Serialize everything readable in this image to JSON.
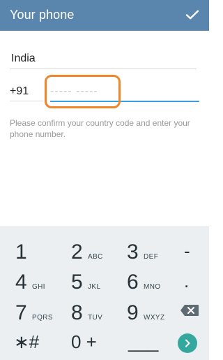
{
  "header": {
    "title": "Your phone",
    "confirm_icon": "checkmark-icon"
  },
  "form": {
    "country": "India",
    "country_code": "+91",
    "phone_placeholder": "----- -----",
    "hint": "Please confirm your country code and enter your phone number."
  },
  "keyboard": {
    "rows": [
      [
        {
          "num": "1",
          "letters": ""
        },
        {
          "num": "2",
          "letters": "ABC"
        },
        {
          "num": "3",
          "letters": "DEF"
        },
        {
          "sym": "-"
        }
      ],
      [
        {
          "num": "4",
          "letters": "GHI"
        },
        {
          "num": "5",
          "letters": "JKL"
        },
        {
          "num": "6",
          "letters": "MNO"
        },
        {
          "sym": "."
        }
      ],
      [
        {
          "num": "7",
          "letters": "PQRS"
        },
        {
          "num": "8",
          "letters": "TUV"
        },
        {
          "num": "9",
          "letters": "WXYZ"
        },
        {
          "icon": "backspace-icon"
        }
      ],
      [
        {
          "sym": "∗#"
        },
        {
          "sym": "0 +"
        },
        {
          "sym": "___"
        },
        {
          "icon": "next-arrow-icon"
        }
      ]
    ]
  },
  "colors": {
    "header_bg": "#5a86ad",
    "accent_blue": "#3a9fe0",
    "highlight_orange": "#f0862a",
    "keyboard_bg": "#eceff1",
    "go_button": "#34a79f"
  }
}
